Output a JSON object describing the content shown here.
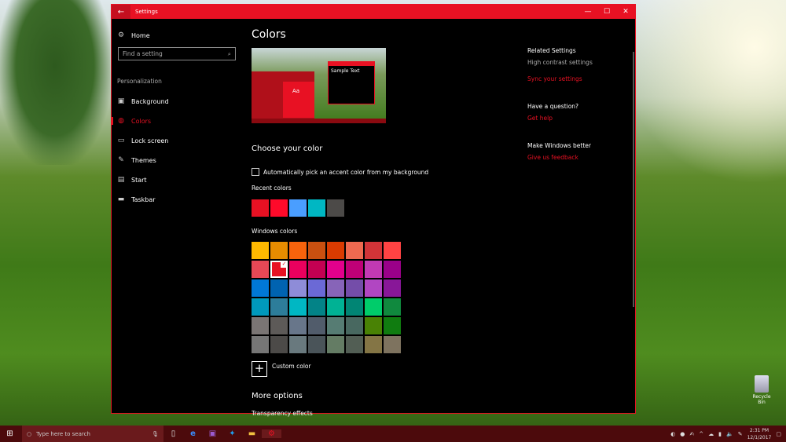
{
  "window": {
    "title": "Settings",
    "back_icon": "←",
    "minimize": "—",
    "maximize": "☐",
    "close": "✕"
  },
  "sidebar": {
    "home": "Home",
    "search_placeholder": "Find a setting",
    "section": "Personalization",
    "items": [
      {
        "label": "Background",
        "icon": "▣"
      },
      {
        "label": "Colors",
        "icon": "◍"
      },
      {
        "label": "Lock screen",
        "icon": "▭"
      },
      {
        "label": "Themes",
        "icon": "✎"
      },
      {
        "label": "Start",
        "icon": "▤"
      },
      {
        "label": "Taskbar",
        "icon": "▬"
      }
    ]
  },
  "main": {
    "title": "Colors",
    "preview_text": "Sample Text",
    "preview_tile": "Aa",
    "choose_heading": "Choose your color",
    "auto_pick_label": "Automatically pick an accent color from my background",
    "auto_pick_checked": false,
    "recent_label": "Recent colors",
    "recent_colors": [
      "#E81123",
      "#FF0A2A",
      "#4A9EFF",
      "#00B7C3",
      "#4C4A48"
    ],
    "windows_label": "Windows colors",
    "windows_colors": [
      [
        "#FFB900",
        "#E78C00",
        "#F7630C",
        "#CA5010",
        "#DA3B01",
        "#EF6950",
        "#D13438",
        "#FF4343"
      ],
      [
        "#E74856",
        "#E81123",
        "#EA005E",
        "#C30052",
        "#E3008C",
        "#BF0077",
        "#C239B3",
        "#9A0089"
      ],
      [
        "#0078D7",
        "#0063B1",
        "#8E8CD8",
        "#6B69D6",
        "#8764B8",
        "#744DA9",
        "#B146C2",
        "#881798"
      ],
      [
        "#0099BC",
        "#2D7D9A",
        "#00B7C3",
        "#038387",
        "#00B294",
        "#018574",
        "#00CC6A",
        "#10893E"
      ],
      [
        "#7A7574",
        "#5D5A58",
        "#68768A",
        "#515C6B",
        "#567C73",
        "#486860",
        "#498205",
        "#107C10"
      ],
      [
        "#767676",
        "#4C4A48",
        "#69797E",
        "#4A5459",
        "#647C64",
        "#525E54",
        "#847545",
        "#7E735F"
      ]
    ],
    "selected_color": "#E81123",
    "custom_color": "Custom color",
    "more_options": "More options",
    "transparency": "Transparency effects"
  },
  "related": {
    "heading": "Related Settings",
    "high_contrast": "High contrast settings",
    "sync": "Sync your settings",
    "question": "Have a question?",
    "get_help": "Get help",
    "better": "Make Windows better",
    "feedback": "Give us feedback"
  },
  "taskbar": {
    "search_placeholder": "Type here to search",
    "time": "2:31 PM",
    "date": "12/1/2017"
  },
  "desktop": {
    "recycle_bin": "Recycle Bin"
  },
  "accent": "#E81123"
}
